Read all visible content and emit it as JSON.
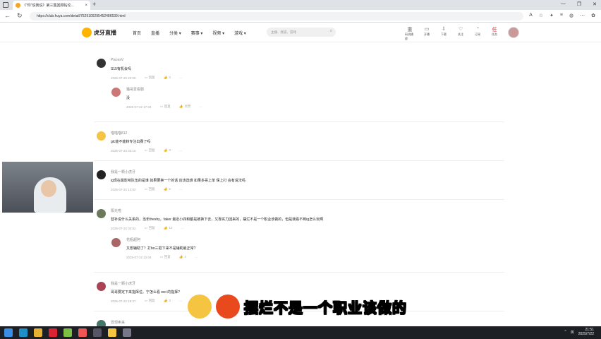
{
  "browser": {
    "tab_title": "《\"你\"说我说》第三集回顾帖论...",
    "tab_close": "×",
    "new_tab": "+",
    "url": "https://club.huya.com/detail/7529100295452486539.html",
    "window_controls": [
      "—",
      "❐",
      "✕"
    ]
  },
  "site": {
    "logo_text": "虎牙直播",
    "nav": [
      "首页",
      "直播",
      "分类 ▾",
      "赛事 ▾",
      "视频 ▾",
      "游戏 ▾"
    ],
    "search_placeholder": "主播、频道、游戏",
    "header_actions": [
      {
        "icon": "重",
        "label": "码流播放"
      },
      {
        "icon": "▭",
        "label": "开播"
      },
      {
        "icon": "⇩",
        "label": "下载"
      },
      {
        "icon": "♡",
        "label": "关注"
      },
      {
        "icon": "◔",
        "label": "订阅"
      },
      {
        "icon": "任",
        "label": "任务"
      }
    ]
  },
  "comments": [
    {
      "name": "PiscesV",
      "text": "S15有机会吗",
      "date": "2025-07-20 20:00",
      "reply": "回复",
      "likes": "3",
      "more": "···"
    },
    {
      "name": "猫哥爱看剧",
      "text": "没",
      "date": "2025-07-22 17:04",
      "reply": "回复",
      "likes": "点赞",
      "more": "···"
    },
    {
      "name": "喵喵喵812",
      "text": "glc能不能转专注出赛了吗",
      "date": "2025-07-22 02:15",
      "reply": "回复",
      "likes": "3",
      "more": "···"
    },
    {
      "name": "我是一颗小虎牙",
      "text": "ig现在最影响队伍的是谁 如果要换一个的话 应该选谁 如果多哥上单 保上打 会有说法吗",
      "date": "2025-07-22 12:02",
      "reply": "回复",
      "likes": "2",
      "more": "···"
    },
    {
      "name": "阳光啦",
      "text": "替补说什么关系的，当年theshy，faker 最近小四和都是被换下去，又靠实力回来的，摆烂不是一个职业该做的，但是我看不到ig怎么玩啊",
      "date": "2025-07-22 02:52",
      "reply": "回复",
      "likes": "12",
      "more": "···"
    },
    {
      "name": "花瓶超阿",
      "text": "又想辅助了？打bo三把下来不是辅助最正常?",
      "date": "2025-07-22 12:04",
      "reply": "回复",
      "likes": "4",
      "more": "···"
    },
    {
      "name": "我是一颗小虎牙",
      "text": "哥哥要定下来指挥位。宁怎么看 wei 的指挥?",
      "date": "2025-07-22 19:37",
      "reply": "回复",
      "likes": "3",
      "more": "···"
    },
    {
      "name": "冒现卖来",
      "text": "",
      "date": "",
      "reply": "",
      "likes": "",
      "more": ""
    }
  ],
  "subtitle": "摆烂不是一个职业该做的",
  "taskbar": {
    "lang": "英",
    "time": "21:51",
    "date": "2025/7/22",
    "tray_arrow": "^"
  }
}
